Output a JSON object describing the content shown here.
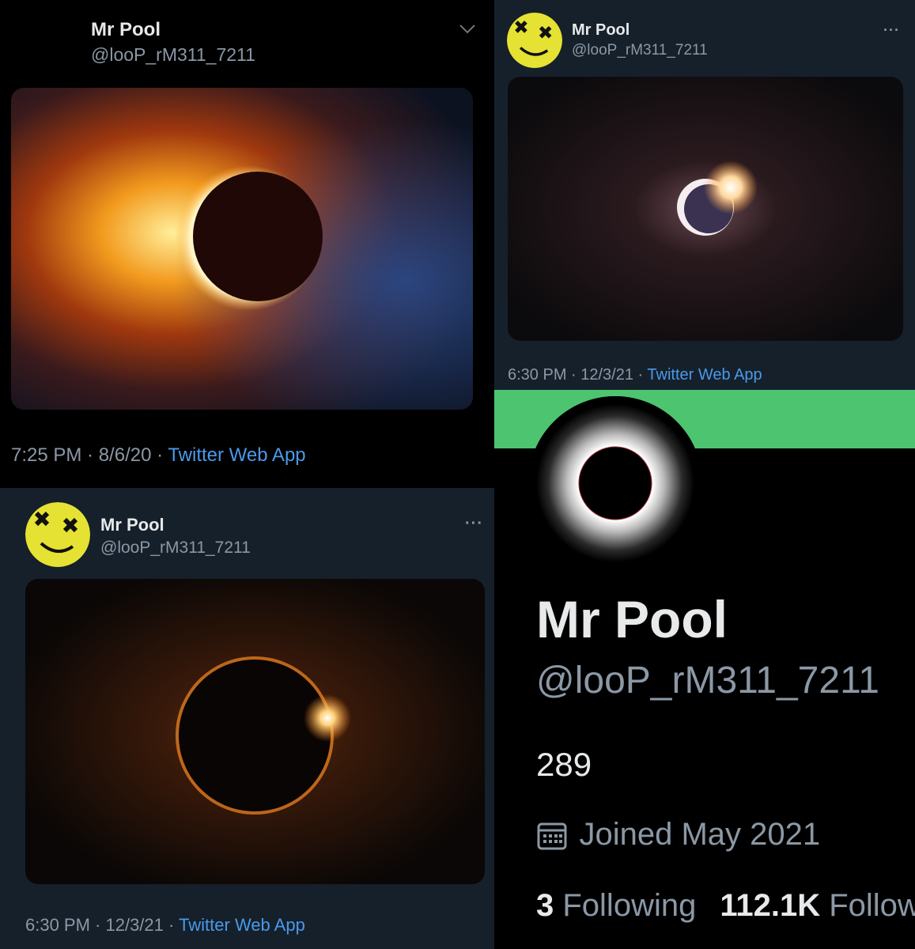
{
  "tweet_a": {
    "name": "Mr Pool",
    "handle": "@looP_rM311_7211",
    "time": "7:25 PM · 8/6/20 · ",
    "source": "Twitter Web App",
    "menu_icon": "chevron-down-icon"
  },
  "tweet_b": {
    "name": "Mr Pool",
    "handle": "@looP_rM311_7211",
    "time": "6:30 PM · 12/3/21 · ",
    "source": "Twitter Web App",
    "menu_icon": "more-icon"
  },
  "tweet_c": {
    "name": "Mr Pool",
    "handle": "@looP_rM311_7211",
    "time": "6:30 PM · 12/3/21 · ",
    "source": "Twitter Web App",
    "menu_icon": "more-icon"
  },
  "profile": {
    "name": "Mr Pool",
    "handle": "@looP_rM311_7211",
    "bio": "289",
    "joined": "Joined May 2021",
    "following_count": "3",
    "following_label": " Following",
    "followers_count": "112.1K",
    "followers_label": " Follow",
    "banner_color": "#4dc46f",
    "calendar_icon": "calendar-icon"
  },
  "colors": {
    "link": "#4a99e9",
    "secondary_text": "#8b98a5",
    "dark_bg": "#15202b"
  }
}
